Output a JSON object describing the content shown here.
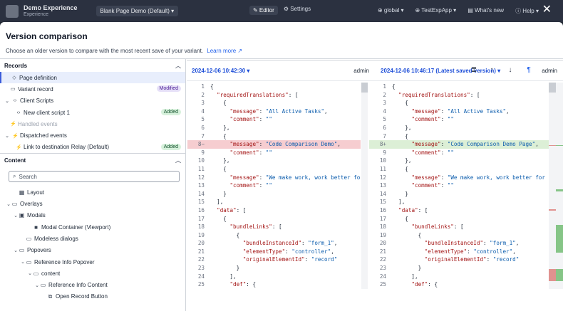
{
  "appbar": {
    "brand_title": "Demo Experience",
    "brand_sub": "Experience",
    "page_selector": "Blank Page Demo (Default) ▾",
    "editor": "✎ Editor",
    "settings": "⚙ Settings",
    "global": "⊕ global ▾",
    "app": "⊕ TestExpApp ▾",
    "whatsnew": "▤ What's new",
    "help": "ⓘ Help ▾"
  },
  "modal": {
    "title": "Version comparison",
    "description": "Choose an older version to compare with the most recent save of your variant.",
    "learn_more": "Learn more ↗"
  },
  "records": {
    "header": "Records",
    "items": [
      {
        "icon": "◇",
        "label": "Page definition",
        "selected": true,
        "badge": "",
        "indent": 1
      },
      {
        "icon": "▭",
        "label": "Variant record",
        "badge": "Modified",
        "badge_type": "mod",
        "indent": 1
      },
      {
        "icon": "‹›",
        "label": "Client Scripts",
        "chev": "⌄",
        "badge": "",
        "indent": 0
      },
      {
        "icon": "‹›",
        "label": "New client script 1",
        "badge": "Added",
        "badge_type": "add",
        "indent": 2
      },
      {
        "icon": "⚡",
        "label": "Handled events",
        "dim": true,
        "badge": "",
        "indent": 1
      },
      {
        "icon": "⚡",
        "label": "Dispatched events",
        "chev": "⌄",
        "badge": "",
        "indent": 0
      },
      {
        "icon": "⚡",
        "label": "Link to destination Relay (Default)",
        "badge": "Added",
        "badge_type": "add",
        "indent": 2
      }
    ]
  },
  "content": {
    "header": "Content",
    "search_placeholder": "Search",
    "tree": [
      {
        "chev": "",
        "icon": "▦",
        "label": "Layout",
        "indent": 1
      },
      {
        "chev": "⌄",
        "icon": "▭",
        "label": "Overlays",
        "indent": 0
      },
      {
        "chev": "⌄",
        "icon": "▣",
        "label": "Modals",
        "indent": 1
      },
      {
        "chev": "",
        "icon": "■",
        "label": "Modal Container (Viewport)",
        "indent": 3
      },
      {
        "chev": "",
        "icon": "▭",
        "label": "Modeless dialogs",
        "indent": 2
      },
      {
        "chev": "⌄",
        "icon": "▭",
        "label": "Popovers",
        "indent": 1
      },
      {
        "chev": "⌄",
        "icon": "▭",
        "label": "Reference Info Popover",
        "indent": 2
      },
      {
        "chev": "⌄",
        "icon": "▭",
        "label": "content",
        "indent": 3
      },
      {
        "chev": "⌄",
        "icon": "▭",
        "label": "Reference Info Content",
        "indent": 4
      },
      {
        "chev": "",
        "icon": "⧉",
        "label": "Open Record Button",
        "indent": 5
      }
    ]
  },
  "versions": {
    "left_version": "2024-12-06 10:42:30 ▾",
    "left_user": "admin",
    "right_version": "2024-12-06 10:46:17 (Latest saved version) ▾",
    "right_user": "admin"
  },
  "toolbar": {
    "list_icon": "≣",
    "up_icon": "↑",
    "down_icon": "↓",
    "pilcrow_icon": "¶",
    "more_icon": "···"
  },
  "left_code": [
    {
      "n": "1",
      "t": "{"
    },
    {
      "n": "2",
      "t": "  \"requiredTranslations\": ["
    },
    {
      "n": "3",
      "t": "    {"
    },
    {
      "n": "4",
      "t": "      \"message\": \"All Active Tasks\","
    },
    {
      "n": "5",
      "t": "      \"comment\": \"\""
    },
    {
      "n": "6",
      "t": "    },"
    },
    {
      "n": "7",
      "t": "    {"
    },
    {
      "n": "8−",
      "t": "      \"message\": \"Code Comparison Demo\",",
      "diff": "del"
    },
    {
      "n": "9",
      "t": "      \"comment\": \"\""
    },
    {
      "n": "10",
      "t": "    },"
    },
    {
      "n": "11",
      "t": "    {"
    },
    {
      "n": "12",
      "t": "      \"message\": \"We make work, work better for"
    },
    {
      "n": "13",
      "t": "      \"comment\": \"\""
    },
    {
      "n": "14",
      "t": "    }"
    },
    {
      "n": "15",
      "t": "  ],"
    },
    {
      "n": "16",
      "t": "  \"data\": ["
    },
    {
      "n": "17",
      "t": "    {"
    },
    {
      "n": "18",
      "t": "      \"bundleLinks\": ["
    },
    {
      "n": "19",
      "t": "        {"
    },
    {
      "n": "20",
      "t": "          \"bundleInstanceId\": \"form_1\","
    },
    {
      "n": "21",
      "t": "          \"elementType\": \"controller\","
    },
    {
      "n": "22",
      "t": "          \"originalElementId\": \"record\""
    },
    {
      "n": "23",
      "t": "        }"
    },
    {
      "n": "24",
      "t": "      ],"
    },
    {
      "n": "25",
      "t": "      \"def\": {"
    }
  ],
  "right_code": [
    {
      "n": "1",
      "t": "{"
    },
    {
      "n": "2",
      "t": "  \"requiredTranslations\": ["
    },
    {
      "n": "3",
      "t": "    {"
    },
    {
      "n": "4",
      "t": "      \"message\": \"All Active Tasks\","
    },
    {
      "n": "5",
      "t": "      \"comment\": \"\""
    },
    {
      "n": "6",
      "t": "    },"
    },
    {
      "n": "7",
      "t": "    {"
    },
    {
      "n": "8+",
      "t": "      \"message\": \"Code Comparison Demo Page\",",
      "diff": "ins"
    },
    {
      "n": "9",
      "t": "      \"comment\": \"\""
    },
    {
      "n": "10",
      "t": "    },"
    },
    {
      "n": "11",
      "t": "    {"
    },
    {
      "n": "12",
      "t": "      \"message\": \"We make work, work better for"
    },
    {
      "n": "13",
      "t": "      \"comment\": \"\""
    },
    {
      "n": "14",
      "t": "    }"
    },
    {
      "n": "15",
      "t": "  ],"
    },
    {
      "n": "16",
      "t": "  \"data\": ["
    },
    {
      "n": "17",
      "t": "    {"
    },
    {
      "n": "18",
      "t": "      \"bundleLinks\": ["
    },
    {
      "n": "19",
      "t": "        {"
    },
    {
      "n": "20",
      "t": "          \"bundleInstanceId\": \"form_1\","
    },
    {
      "n": "21",
      "t": "          \"elementType\": \"controller\","
    },
    {
      "n": "22",
      "t": "          \"originalElementId\": \"record\""
    },
    {
      "n": "23",
      "t": "        }"
    },
    {
      "n": "24",
      "t": "      ],"
    },
    {
      "n": "25",
      "t": "      \"def\": {"
    }
  ],
  "colors": {
    "accent": "#1d4ed8",
    "deleted": "#f6cdd0",
    "inserted": "#dcefd6"
  },
  "close_icon": "✕"
}
